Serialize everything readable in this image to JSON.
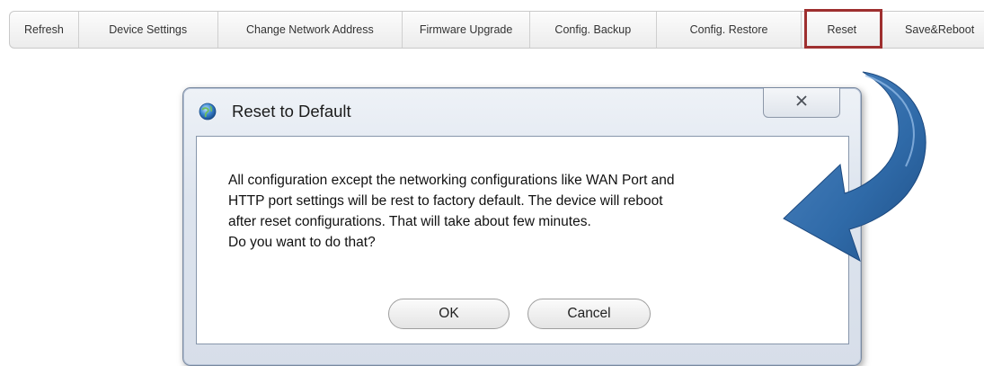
{
  "toolbar": {
    "buttons": [
      "Refresh",
      "Device Settings",
      "Change Network Address",
      "Firmware Upgrade",
      "Config. Backup",
      "Config. Restore",
      "Reset",
      "Save&Reboot"
    ],
    "highlighted": "Reset",
    "highlight_color": "#9e2f2f"
  },
  "dialog": {
    "title": "Reset to Default",
    "close_icon": "close-icon",
    "message_lines": [
      "All configuration except the networking configurations like WAN Port and",
      "HTTP port settings will be rest to factory default. The device will reboot",
      "after reset configurations. That will take about few minutes.",
      "Do you want to do that?"
    ],
    "ok_label": "OK",
    "cancel_label": "Cancel"
  },
  "annotation": {
    "arrow_color": "#2f6aa8",
    "arrow_icon": "curved-arrow-icon"
  }
}
